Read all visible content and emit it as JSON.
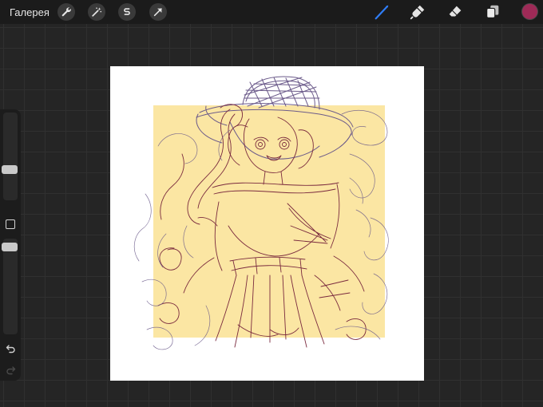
{
  "topbar": {
    "gallery_label": "Галерея",
    "left_tools": [
      {
        "icon": "wrench-icon",
        "name": "actions"
      },
      {
        "icon": "magic-wand-icon",
        "name": "adjustments"
      },
      {
        "icon": "s-selection-icon",
        "name": "selection"
      },
      {
        "icon": "arrow-cursor-icon",
        "name": "transform"
      }
    ],
    "right_tools": [
      {
        "icon": "brush-icon",
        "name": "brush",
        "active": true
      },
      {
        "icon": "smudge-icon",
        "name": "smudge",
        "active": false
      },
      {
        "icon": "eraser-icon",
        "name": "eraser",
        "active": false
      },
      {
        "icon": "layers-icon",
        "name": "layers",
        "active": false
      }
    ],
    "active_color": "#9e2a57"
  },
  "sidebar": {
    "brush_size_level": 0.33,
    "opacity_level": 0.95
  },
  "canvas": {
    "background_color": "#ffffff",
    "fill_color": "#fbe6a3",
    "stroke_colors": [
      "#7a2a3e",
      "#6b5a8a"
    ]
  }
}
